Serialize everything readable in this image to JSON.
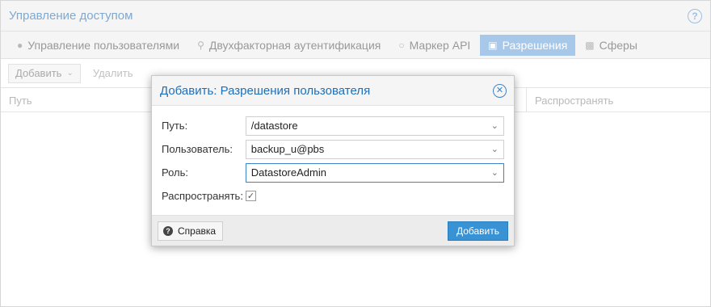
{
  "panel": {
    "title": "Управление доступом",
    "help_icon": "question-circle-icon",
    "tabs": [
      {
        "label": "Управление пользователями",
        "icon": "user-icon",
        "active": false
      },
      {
        "label": "Двухфакторная аутентификация",
        "icon": "key-icon",
        "active": false
      },
      {
        "label": "Маркер API",
        "icon": "user-outline-icon",
        "active": false
      },
      {
        "label": "Разрешения",
        "icon": "unlock-icon",
        "active": true
      },
      {
        "label": "Сферы",
        "icon": "address-book-icon",
        "active": false
      }
    ],
    "toolbar": {
      "add_label": "Добавить",
      "remove_label": "Удалить"
    },
    "columns": [
      "Путь",
      "Распространять"
    ]
  },
  "dialog": {
    "title": "Добавить: Разрешения пользователя",
    "fields": {
      "path": {
        "label": "Путь:",
        "value": "/datastore"
      },
      "user": {
        "label": "Пользователь:",
        "value": "backup_u@pbs"
      },
      "role": {
        "label": "Роль:",
        "value": "DatastoreAdmin"
      },
      "propagate": {
        "label": "Распространять:",
        "checked": true
      }
    },
    "help_label": "Справка",
    "submit_label": "Добавить"
  },
  "colors": {
    "accent": "#3892d4",
    "title_blue": "#1f6fb8",
    "active_tab": "#a8c8ea"
  }
}
